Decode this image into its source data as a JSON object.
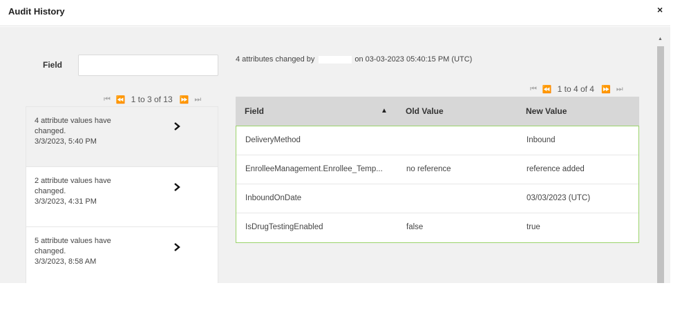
{
  "dialog": {
    "title": "Audit History",
    "close_glyph": "×"
  },
  "filter": {
    "label": "Field",
    "value": "",
    "placeholder": ""
  },
  "left_pager": {
    "first_glyph": "⏮",
    "prev_glyph": "⏪",
    "text": "1 to 3 of 13",
    "next_glyph": "⏩",
    "last_glyph": "⏭"
  },
  "changes": [
    {
      "line1": "4 attribute values have",
      "line2": "changed.",
      "line3": "3/3/2023, 5:40 PM",
      "chevron": "›",
      "selected": true
    },
    {
      "line1": "2 attribute values have",
      "line2": "changed.",
      "line3": "3/3/2023, 4:31 PM",
      "chevron": "›",
      "selected": false
    },
    {
      "line1": "5 attribute values have",
      "line2": "changed.",
      "line3": "3/3/2023, 8:58 AM",
      "chevron": "›",
      "selected": false
    }
  ],
  "summary": {
    "prefix": "4 attributes changed by",
    "suffix": "on 03-03-2023 05:40:15 PM (UTC)"
  },
  "right_pager": {
    "first_glyph": "⏮",
    "prev_glyph": "⏪",
    "text": "1 to 4 of 4",
    "next_glyph": "⏩",
    "last_glyph": "⏭"
  },
  "grid": {
    "headers": [
      "Field",
      "Old Value",
      "New Value"
    ],
    "sort_glyph": "▲",
    "rows": [
      [
        "DeliveryMethod",
        "",
        "Inbound"
      ],
      [
        "EnrolleeManagement.Enrollee_Temp...",
        "no reference",
        "reference added"
      ],
      [
        "InboundOnDate",
        "",
        "03/03/2023 (UTC)"
      ],
      [
        "IsDrugTestingEnabled",
        "false",
        "true"
      ]
    ]
  },
  "colors": {
    "accent_border": "#9ad36a",
    "header_bg": "#d7d7d7",
    "panel_bg": "#f1f1f1"
  },
  "scrollbar": {
    "up_glyph": "▲"
  }
}
